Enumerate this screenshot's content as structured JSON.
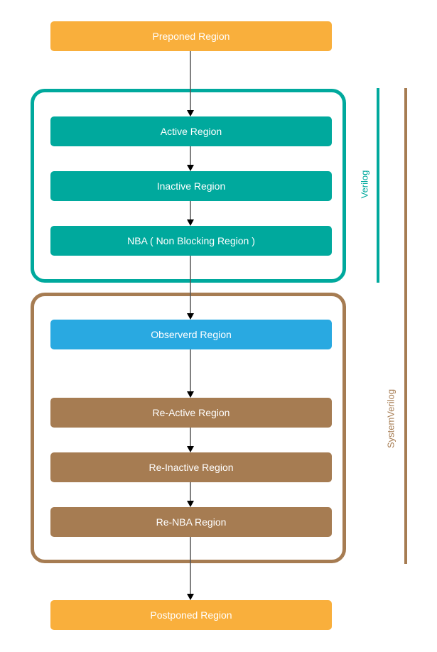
{
  "colors": {
    "orange": "#F9AF3C",
    "teal": "#00A99D",
    "blue": "#29A9E1",
    "brown": "#A67C52",
    "arrow": "#555555"
  },
  "groups": {
    "verilog": {
      "label": "Verilog"
    },
    "systemverilog": {
      "label": "SystemVerilog"
    }
  },
  "regions": [
    {
      "id": "preponed",
      "label": "Preponed Region",
      "color": "orange"
    },
    {
      "id": "active",
      "label": "Active Region",
      "color": "teal"
    },
    {
      "id": "inactive",
      "label": "Inactive Region",
      "color": "teal"
    },
    {
      "id": "nba",
      "label": "NBA ( Non Blocking Region )",
      "color": "teal"
    },
    {
      "id": "observed",
      "label": "Observerd Region",
      "color": "blue"
    },
    {
      "id": "re-active",
      "label": "Re-Active Region",
      "color": "brown"
    },
    {
      "id": "re-inactive",
      "label": "Re-Inactive Region",
      "color": "brown"
    },
    {
      "id": "re-nba",
      "label": "Re-NBA Region",
      "color": "brown"
    },
    {
      "id": "postponed",
      "label": "Postponed Region",
      "color": "orange"
    }
  ]
}
